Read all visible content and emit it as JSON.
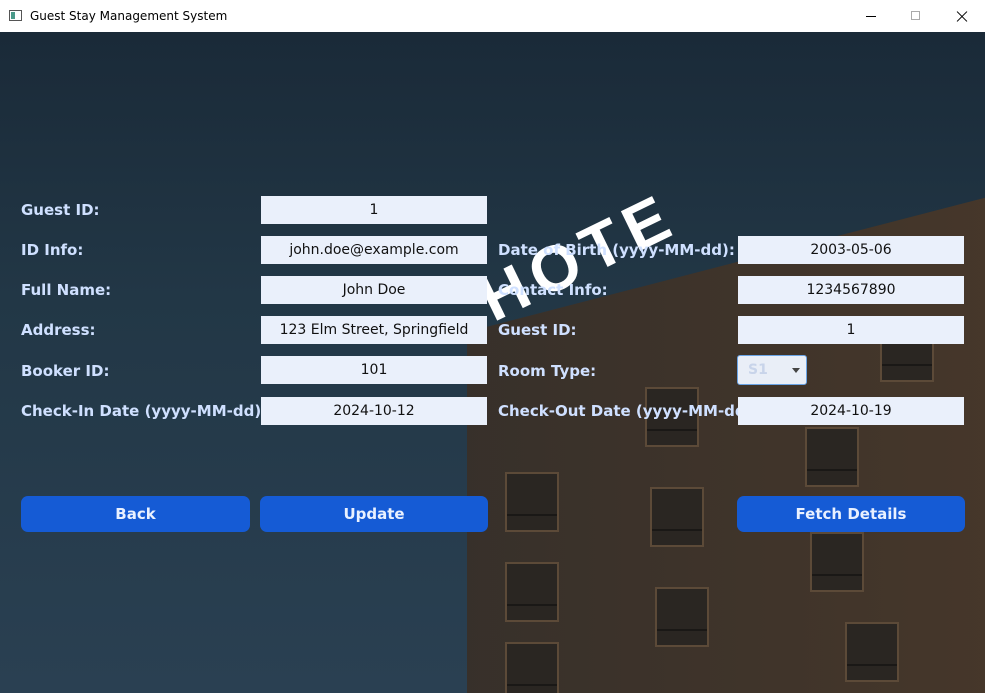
{
  "window": {
    "title": "Guest Stay Management System"
  },
  "background": {
    "sign_text": "HOTE"
  },
  "form": {
    "left": [
      {
        "label": "Guest ID:",
        "value": "1"
      },
      {
        "label": "ID Info:",
        "value": "john.doe@example.com"
      },
      {
        "label": "Full Name:",
        "value": "John Doe"
      },
      {
        "label": "Address:",
        "value": "123 Elm Street, Springfield"
      },
      {
        "label": "Booker ID:",
        "value": "101"
      },
      {
        "label": "Check-In Date (yyyy-MM-dd):",
        "value": "2024-10-12"
      }
    ],
    "right": [
      {
        "label": "Date of Birth (yyyy-MM-dd):",
        "value": "2003-05-06"
      },
      {
        "label": "Contact Info:",
        "value": "1234567890"
      },
      {
        "label": "Guest ID:",
        "value": "1"
      },
      {
        "label": "Room Type:",
        "value": "S1"
      },
      {
        "label": "Check-Out Date (yyyy-MM-dd):",
        "value": "2024-10-19"
      }
    ]
  },
  "buttons": {
    "back": "Back",
    "update": "Update",
    "fetch": "Fetch Details"
  },
  "colors": {
    "accent": "#155bd5",
    "label": "#cfe0ff",
    "field_bg": "#eaf0fb"
  }
}
